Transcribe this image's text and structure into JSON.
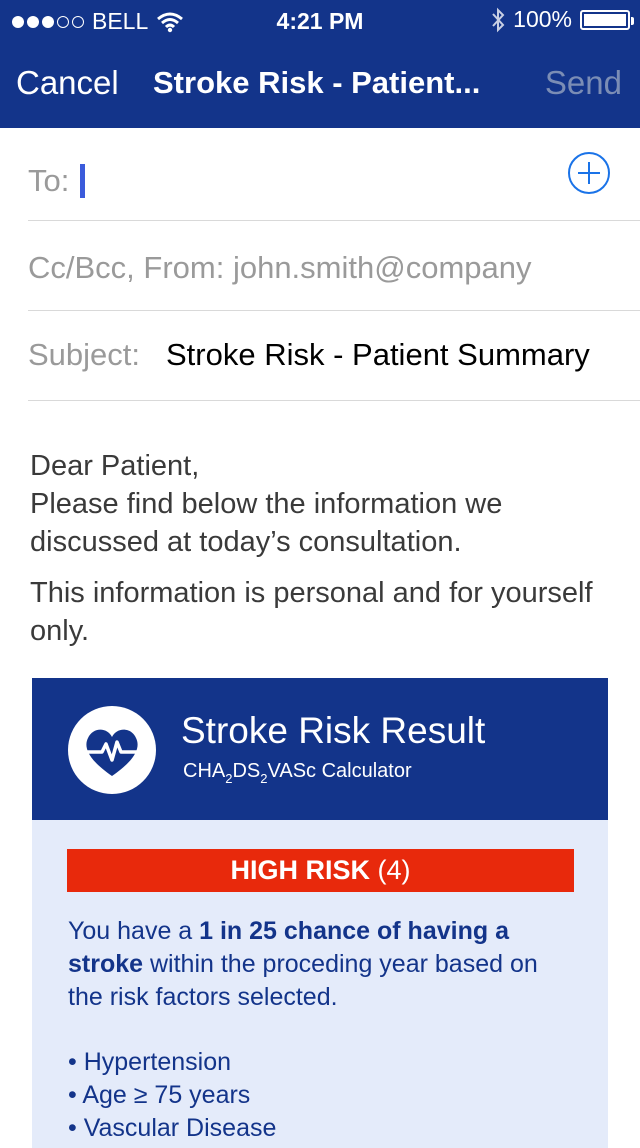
{
  "status_bar": {
    "signal_dots_full": 3,
    "signal_dots_total": 5,
    "carrier": "BELL",
    "time": "4:21 PM",
    "battery": "100%"
  },
  "nav": {
    "cancel_label": "Cancel",
    "title": "Stroke Risk - Patient...",
    "send_label": "Send"
  },
  "compose": {
    "to_label": "To:",
    "cc_label": "Cc/Bcc, From: john.smith@company",
    "subject_label": "Subject:",
    "subject_value": "Stroke Risk - Patient Summary"
  },
  "body": {
    "greeting": "Dear Patient,",
    "line1": "Please find below the information we discussed at today’s consultation.",
    "line2": "This information is personal and for yourself only."
  },
  "card": {
    "title": "Stroke Risk Result",
    "subtitle_parts": [
      "CHA",
      "2",
      "DS",
      "2",
      "VASc Calculator"
    ],
    "risk_label": "HIGH RISK",
    "risk_score": "(4)",
    "summary_prefix": "You have a ",
    "summary_bold": "1 in 25 chance of having a stroke",
    "summary_suffix": " within the proceding year based on the risk factors selected.",
    "factors": [
      "Hypertension",
      "Age ≥ 75 years",
      "Vascular Disease"
    ]
  },
  "colors": {
    "header_bg": "#13348a",
    "risk_red": "#e8290c",
    "card_bg": "#e4ebfa",
    "link_blue": "#1a73e8"
  }
}
